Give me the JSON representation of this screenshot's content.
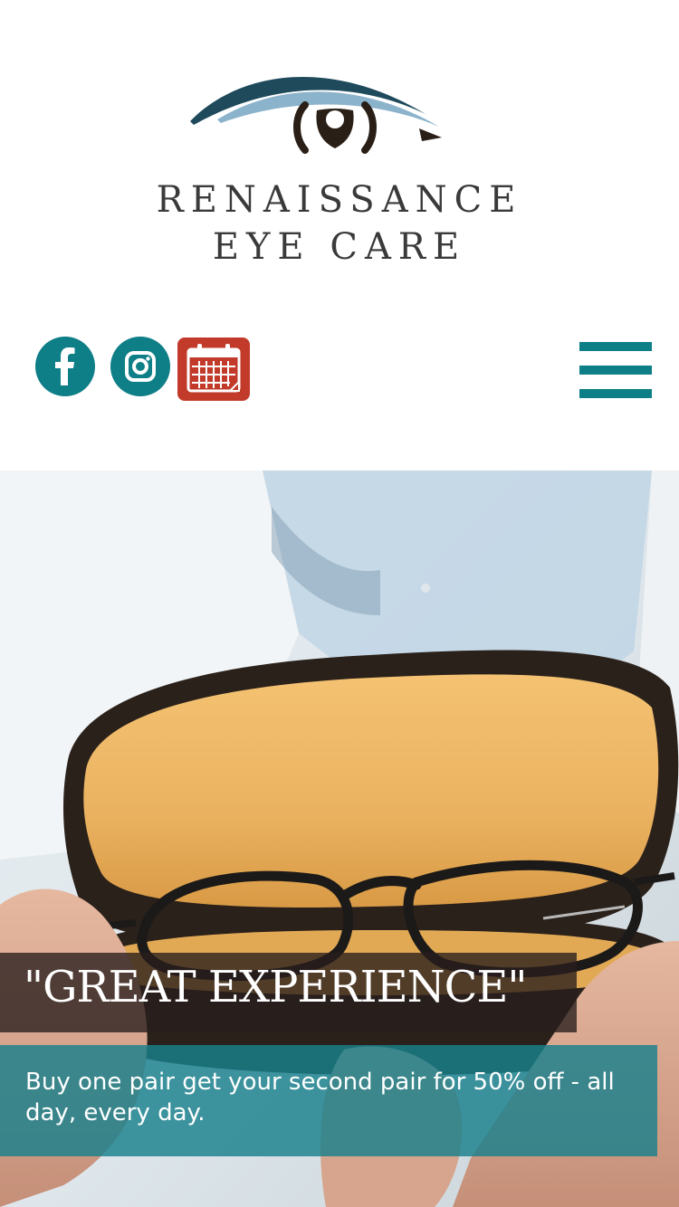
{
  "brand": {
    "line1": "RENAISSANCE",
    "line2": "EYE CARE",
    "colors": {
      "teal": "#0e7e87",
      "dark_teal": "#1e4a5c",
      "light_blue": "#8cb3cc",
      "calendar_red": "#c23a2a"
    }
  },
  "social": [
    {
      "name": "facebook",
      "icon": "facebook-icon"
    },
    {
      "name": "instagram",
      "icon": "instagram-icon"
    },
    {
      "name": "appointment",
      "icon": "calendar-icon"
    }
  ],
  "menu": {
    "icon": "hamburger-menu-icon"
  },
  "hero": {
    "image": "person-holding-glasses-case",
    "quote": "\"GREAT EXPERIENCE\"",
    "promo": "Buy one pair get your second pair for 50% off - all day, every day."
  }
}
